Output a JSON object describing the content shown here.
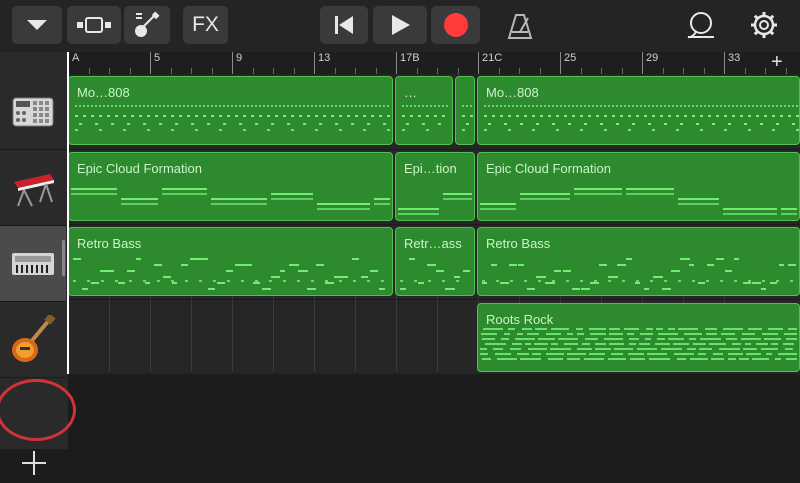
{
  "toolbar": {
    "browser_label": "",
    "view_label": "",
    "instrument_label": "",
    "fx_label": "FX",
    "rewind_label": "",
    "play_label": "",
    "record_label": "",
    "metronome_label": "",
    "loop_label": "",
    "settings_label": ""
  },
  "ruler": {
    "bars": [
      "A",
      "5",
      "9",
      "13",
      "17B",
      "21C",
      "25",
      "29",
      "33"
    ]
  },
  "tracks": [
    {
      "instrument": "drum-machine"
    },
    {
      "instrument": "keyboard-synth"
    },
    {
      "instrument": "bass-synth"
    },
    {
      "instrument": "electric-guitar"
    }
  ],
  "regions": [
    {
      "track": 1,
      "name": "Mo…808"
    },
    {
      "track": 1,
      "name": "…"
    },
    {
      "track": 1,
      "name": ""
    },
    {
      "track": 1,
      "name": "Mo…808"
    },
    {
      "track": 2,
      "name": "Epic Cloud Formation"
    },
    {
      "track": 2,
      "name": "Epi…tion"
    },
    {
      "track": 2,
      "name": "Epic Cloud Formation"
    },
    {
      "track": 3,
      "name": "Retro Bass"
    },
    {
      "track": 3,
      "name": "Retr…ass"
    },
    {
      "track": 3,
      "name": "Retro Bass"
    },
    {
      "track": 4,
      "name": "Roots Rock"
    }
  ],
  "colors": {
    "region_fill": "#2e8a2e",
    "region_border": "#4fc24f",
    "note": "#7dff7d",
    "record": "#ff3b3b",
    "highlight_circle": "#d2323a"
  },
  "add_track_label": "+",
  "add_section_label": "+"
}
